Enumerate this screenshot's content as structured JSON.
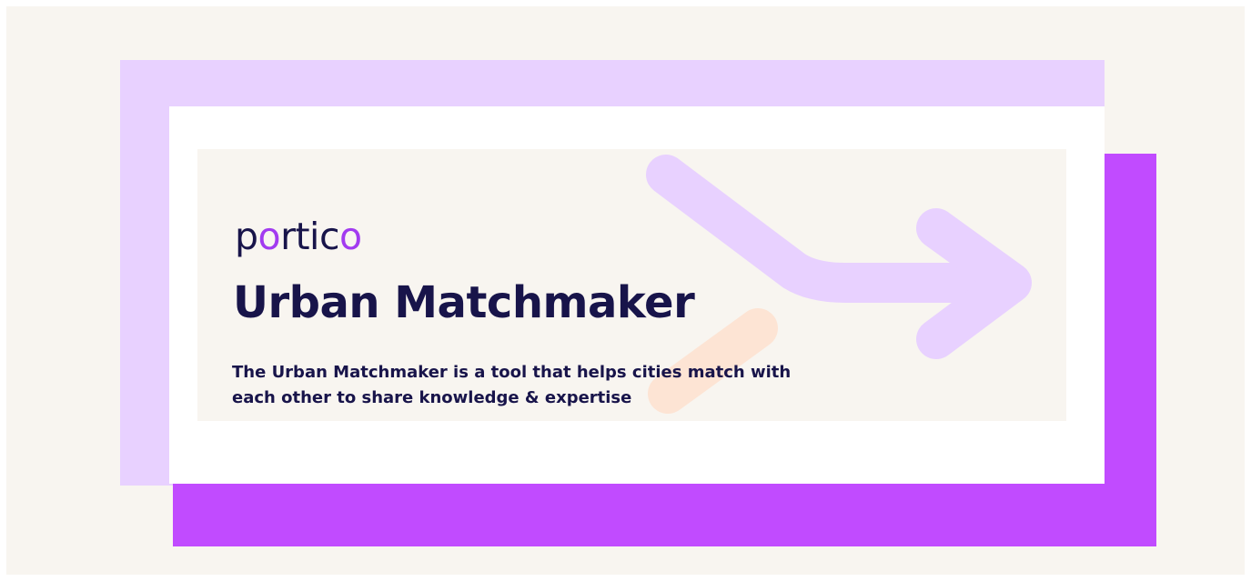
{
  "brand": {
    "logo_text_part1": "p",
    "logo_accent_o1": "o",
    "logo_text_part2": "rtic",
    "logo_accent_o2": "o"
  },
  "hero": {
    "title": "Urban Matchmaker",
    "description": "The Urban Matchmaker is a tool that helps cities match with each other to share knowledge & expertise"
  },
  "colors": {
    "background": "#f8f5f0",
    "lilac_block": "#e8d1ff",
    "purple_block": "#c14bff",
    "card": "#ffffff",
    "text": "#18144a",
    "logo_accent": "#a23bf0",
    "arrow_decoration": "#e8d1ff",
    "peach_decoration": "#fde4d4"
  },
  "icons": {
    "arrow": "bent-arrow-right-icon",
    "stroke": "peach-stroke-decoration"
  }
}
